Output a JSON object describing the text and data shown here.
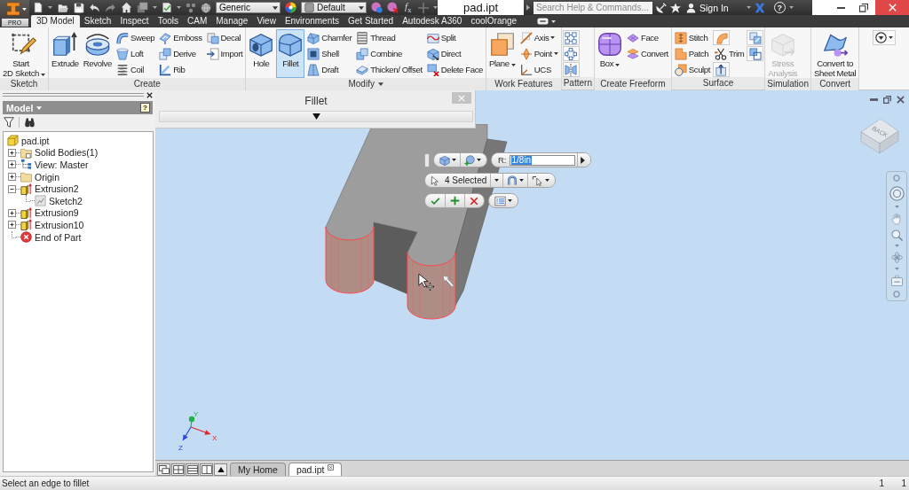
{
  "app_button": {
    "badge": "PRO"
  },
  "quick_access": {
    "material": "Generic",
    "appearance": "Default",
    "function_label": "*f*$_{x}$"
  },
  "window": {
    "title": "pad.ipt"
  },
  "help_bar": {
    "search": {
      "placeholder": "Search Help & Commands..."
    },
    "sign_in": "Sign In",
    "help": "?"
  },
  "tabs": [
    {
      "label": "3D Model",
      "selected": true
    },
    {
      "label": "Sketch",
      "selected": false
    },
    {
      "label": "Inspect",
      "selected": false
    },
    {
      "label": "Tools",
      "selected": false
    },
    {
      "label": "CAM",
      "selected": false
    },
    {
      "label": "Manage",
      "selected": false
    },
    {
      "label": "View",
      "selected": false
    },
    {
      "label": "Environments",
      "selected": false
    },
    {
      "label": "Get Started",
      "selected": false
    },
    {
      "label": "Autodesk A360",
      "selected": false
    },
    {
      "label": "coolOrange",
      "selected": false
    }
  ],
  "ribbon": {
    "panels": [
      {
        "title": "Sketch",
        "menu": false,
        "groups": [
          {
            "kind": "large",
            "label": "Start\n2D Sketch",
            "active": false,
            "disabled": false,
            "menu": true
          }
        ]
      },
      {
        "title": "Create",
        "menu": false,
        "groups": [
          {
            "kind": "large",
            "label": "Extrude",
            "active": false,
            "disabled": false
          },
          {
            "kind": "large",
            "label": "Revolve",
            "active": false,
            "disabled": false
          },
          {
            "kind": "stack",
            "tools": [
              {
                "label": "Sweep",
                "active": false,
                "disabled": false
              },
              {
                "label": "Loft",
                "active": false,
                "disabled": false
              },
              {
                "label": "Coil",
                "active": false,
                "disabled": false
              }
            ]
          },
          {
            "kind": "stack",
            "tools": [
              {
                "label": "Emboss",
                "active": false,
                "disabled": false
              },
              {
                "label": "Derive",
                "active": false,
                "disabled": false
              },
              {
                "label": "Rib",
                "active": false,
                "disabled": false
              }
            ]
          },
          {
            "kind": "stack",
            "tools": [
              {
                "label": "Decal",
                "active": false,
                "disabled": false
              },
              {
                "label": "Import",
                "active": false,
                "disabled": false
              }
            ]
          }
        ]
      },
      {
        "title": "Modify",
        "menu": true,
        "groups": [
          {
            "kind": "large",
            "label": "Hole",
            "active": false,
            "disabled": false
          },
          {
            "kind": "large",
            "label": "Fillet",
            "active": true,
            "disabled": false
          },
          {
            "kind": "stack",
            "tools": [
              {
                "label": "Chamfer",
                "active": false,
                "disabled": false
              },
              {
                "label": "Shell",
                "active": false,
                "disabled": false
              },
              {
                "label": "Draft",
                "active": false,
                "disabled": false
              }
            ]
          },
          {
            "kind": "stack",
            "tools": [
              {
                "label": "Thread",
                "active": false,
                "disabled": false
              },
              {
                "label": "Combine",
                "active": false,
                "disabled": false
              },
              {
                "label": "Thicken/ Offset",
                "active": false,
                "disabled": false
              }
            ]
          },
          {
            "kind": "stack",
            "tools": [
              {
                "label": "Split",
                "active": false,
                "disabled": false
              },
              {
                "label": "Direct",
                "active": false,
                "disabled": false
              },
              {
                "label": "Delete Face",
                "active": false,
                "disabled": false
              }
            ]
          }
        ]
      },
      {
        "title": "Work Features",
        "menu": false,
        "groups": [
          {
            "kind": "large",
            "label": "Plane",
            "active": false,
            "disabled": false,
            "menu": true
          },
          {
            "kind": "stack",
            "tools": [
              {
                "label": "Axis",
                "active": false,
                "disabled": false,
                "menu": true
              },
              {
                "label": "Point",
                "active": false,
                "disabled": false,
                "menu": true
              },
              {
                "label": "UCS",
                "active": false,
                "disabled": false
              }
            ]
          }
        ]
      },
      {
        "title": "Pattern",
        "menu": false,
        "groups": [
          {
            "kind": "stack",
            "tools": [
              {
                "active": false,
                "disabled": false
              },
              {
                "active": false,
                "disabled": false
              },
              {
                "active": false,
                "disabled": false
              }
            ]
          }
        ]
      },
      {
        "title": "Create Freeform",
        "menu": false,
        "groups": [
          {
            "kind": "large",
            "label": "Box",
            "active": false,
            "disabled": false,
            "menu": true
          },
          {
            "kind": "stack",
            "tools": [
              {
                "label": "Face",
                "active": false,
                "disabled": false
              },
              {
                "label": "Convert",
                "active": false,
                "disabled": false
              }
            ]
          }
        ]
      },
      {
        "title": "Surface",
        "menu": false,
        "groups": [
          {
            "kind": "stack",
            "tools": [
              {
                "label": "Stitch",
                "active": false,
                "disabled": false
              },
              {
                "label": "Patch",
                "active": false,
                "disabled": false
              },
              {
                "label": "Sculpt",
                "active": false,
                "disabled": false
              }
            ]
          },
          {
            "kind": "stack",
            "tools": [
              {
                "active": false,
                "disabled": false
              },
              {
                "label": "Trim",
                "active": false,
                "disabled": false
              },
              {
                "active": false,
                "disabled": false
              }
            ]
          },
          {
            "kind": "stack",
            "tools": [
              {
                "active": false,
                "disabled": false
              },
              {
                "active": false,
                "disabled": false
              }
            ]
          }
        ]
      },
      {
        "title": "Simulation",
        "menu": false,
        "groups": [
          {
            "kind": "large",
            "label": "Stress\nAnalysis",
            "active": false,
            "disabled": true
          }
        ]
      },
      {
        "title": "Convert",
        "menu": false,
        "groups": [
          {
            "kind": "large",
            "label": "Convert to\nSheet Metal",
            "active": false,
            "disabled": false
          }
        ]
      }
    ]
  },
  "browser": {
    "title": "Model",
    "help": "?",
    "tree": [
      {
        "label": "pad.ipt",
        "kind": "part",
        "children": [
          {
            "label": "Solid Bodies(1)",
            "kind": "bodies",
            "expanded": false
          },
          {
            "label": "View: Master",
            "kind": "view",
            "expanded": false
          },
          {
            "label": "Origin",
            "kind": "folder",
            "expanded": false
          },
          {
            "label": "Extrusion2",
            "kind": "extrusion",
            "expanded": true,
            "children": [
              {
                "label": "Sketch2",
                "kind": "sketch"
              }
            ]
          },
          {
            "label": "Extrusion9",
            "kind": "extrusion",
            "expanded": false
          },
          {
            "label": "Extrusion10",
            "kind": "extrusion",
            "expanded": false
          },
          {
            "label": "End of Part",
            "kind": "end"
          }
        ]
      }
    ]
  },
  "fillet_dialog": {
    "title": "Fillet",
    "expanded": false
  },
  "mini_toolbar": {
    "radius_label": "R:",
    "radius_value": "1/8in",
    "value_selected": true,
    "selection": "4 Selected"
  },
  "view_cube": {
    "face": "BACK"
  },
  "triad": [
    {
      "label": "X",
      "color": "#e02828"
    },
    {
      "label": "Y",
      "color": "#22b04a"
    },
    {
      "label": "Z",
      "color": "#2848e0"
    }
  ],
  "doc_tabs": [
    {
      "label": "My Home",
      "selected": false
    },
    {
      "label": "pad.ipt",
      "selected": true
    }
  ],
  "status_bar": {
    "message": "Select an edge to fillet",
    "counters": [
      "1",
      "1"
    ]
  }
}
